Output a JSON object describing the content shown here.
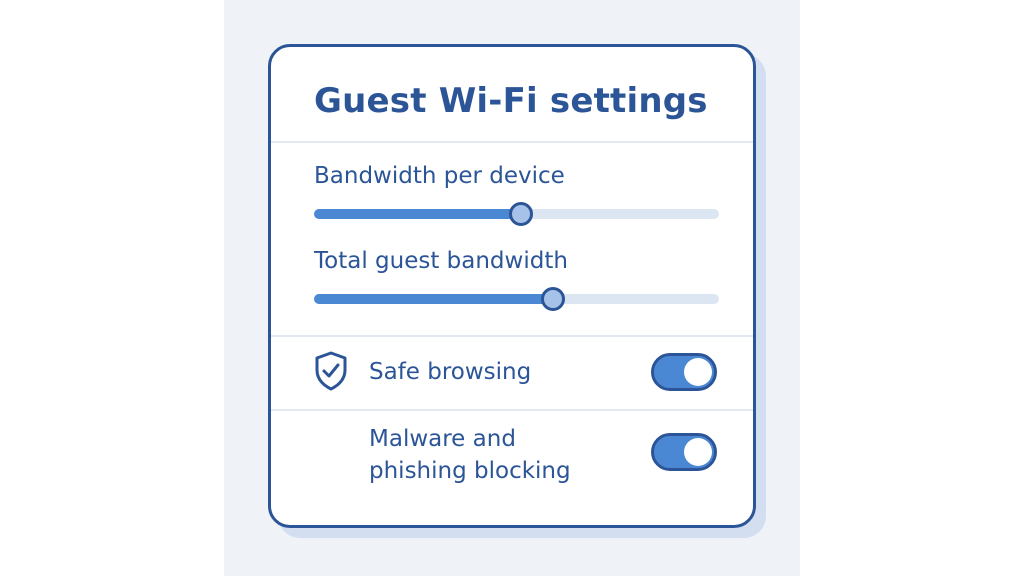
{
  "panel": {
    "title": "Guest Wi-Fi settings"
  },
  "sliders": [
    {
      "label": "Bandwidth per device",
      "value": 0.51
    },
    {
      "label": "Total guest bandwidth",
      "value": 0.59
    }
  ],
  "toggles": [
    {
      "label": "Safe browsing",
      "icon": "shield-check-icon",
      "on": true
    },
    {
      "label_line1": "Malware and",
      "label_line2": "phishing blocking",
      "on": true
    }
  ],
  "colors": {
    "accent": "#2b5597",
    "fill": "#4a88d4",
    "track": "#dce6f3",
    "thumb": "#a7c2e8",
    "backdrop": "#eff2f7"
  }
}
